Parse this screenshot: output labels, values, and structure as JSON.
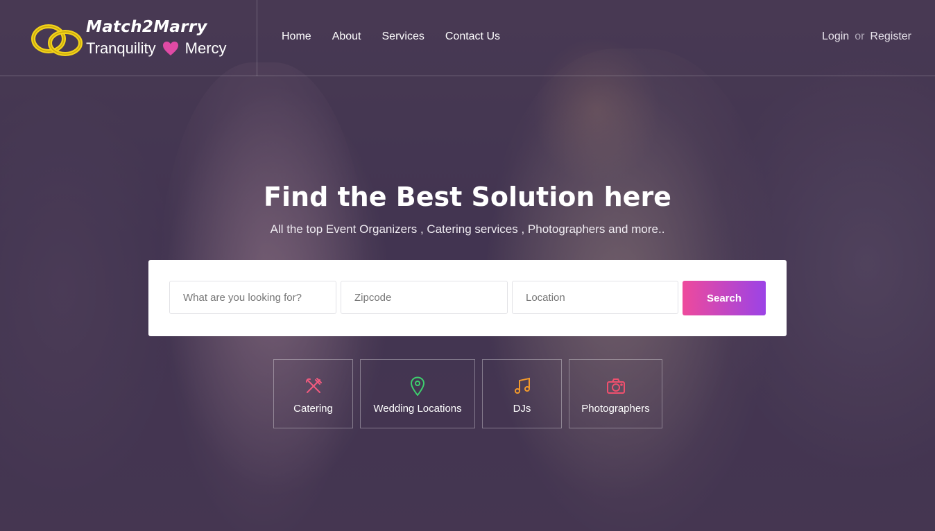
{
  "brand": {
    "title": "Match2Marry",
    "tagline_left": "Tranquility",
    "tagline_right": "Mercy",
    "heart_color": "#e04aa5",
    "ring_color": "#f2d21a"
  },
  "nav": {
    "items": [
      {
        "label": "Home"
      },
      {
        "label": "About"
      },
      {
        "label": "Services"
      },
      {
        "label": "Contact Us"
      }
    ]
  },
  "auth": {
    "login": "Login",
    "or": "or",
    "register": "Register"
  },
  "hero": {
    "title": "Find the Best Solution here",
    "subtitle": "All the top Event Organizers , Catering services , Photographers and more.."
  },
  "search": {
    "keyword_placeholder": "What are you looking for?",
    "zipcode_placeholder": "Zipcode",
    "location_placeholder": "Location",
    "button_label": "Search",
    "button_gradient": [
      "#ee4a9c",
      "#9b43e6"
    ]
  },
  "categories": [
    {
      "label": "Catering",
      "icon": "utensils-icon",
      "color": "#f05a7e"
    },
    {
      "label": "Wedding Locations",
      "icon": "map-pin-icon",
      "color": "#3ecf6e"
    },
    {
      "label": "DJs",
      "icon": "music-note-icon",
      "color": "#f39a2b"
    },
    {
      "label": "Photographers",
      "icon": "camera-icon",
      "color": "#f0506e"
    }
  ]
}
